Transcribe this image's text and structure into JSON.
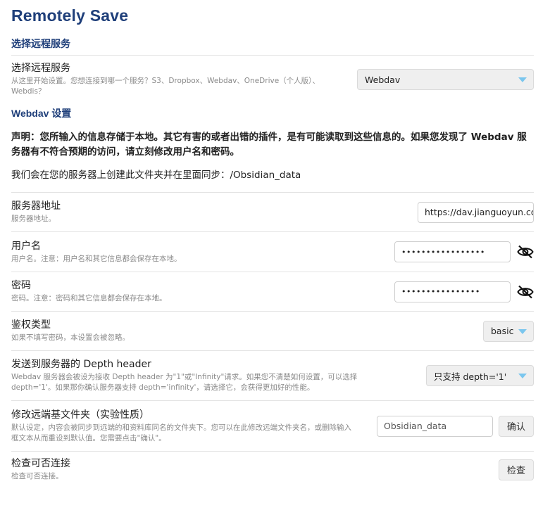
{
  "title": "Remotely Save",
  "sections": {
    "choose_service": "选择远程服务",
    "webdav_settings": "Webdav 设置"
  },
  "service_row": {
    "name": "选择远程服务",
    "desc": "从这里开始设置。您想连接到哪一个服务？S3、Dropbox、Webdav、OneDrive（个人版）、Webdis？",
    "selected": "Webdav"
  },
  "notice": "声明：您所输入的信息存储于本地。其它有害的或者出错的插件，是有可能读取到这些信息的。如果您发现了 Webdav 服务器有不符合预期的访问，请立刻修改用户名和密码。",
  "folder_note": "我们会在您的服务器上创建此文件夹并在里面同步：/Obsidian_data",
  "server_row": {
    "name": "服务器地址",
    "desc": "服务器地址。",
    "value": "https://dav.jianguoyun.com/dav/"
  },
  "username_row": {
    "name": "用户名",
    "desc": "用户名。注意：用户名和其它信息都会保存在本地。",
    "value": "•••••••••••••••••"
  },
  "password_row": {
    "name": "密码",
    "desc": "密码。注意：密码和其它信息都会保存在本地。",
    "value": "••••••••••••••••"
  },
  "auth_row": {
    "name": "鉴权类型",
    "desc": "如果不填写密码，本设置会被忽略。",
    "selected": "basic"
  },
  "depth_row": {
    "name": "发送到服务器的 Depth header",
    "desc": "Webdav 服务器会被设为接收 Depth header 为\"1\"或\"Infinity\"请求。如果您不清楚如何设置，可以选择 depth='1'。如果那你确认服务器支持 depth='infinity'，请选择它，会获得更加好的性能。",
    "selected": "只支持 depth='1'"
  },
  "remote_dir_row": {
    "name": "修改远端基文件夹（实验性质）",
    "desc": "默认设定，内容会被同步到远端的和资料库同名的文件夹下。您可以在此修改远端文件夹名，或删除输入框文本从而重设到默认值。您需要点击\"确认\"。",
    "value": "Obsidian_data",
    "confirm_label": "确认"
  },
  "check_row": {
    "name": "检查可否连接",
    "desc": "检查可否连接。",
    "button_label": "检查"
  },
  "colors": {
    "heading": "#1f3f7a",
    "dropdown_arrow": "#7ac6ee"
  }
}
